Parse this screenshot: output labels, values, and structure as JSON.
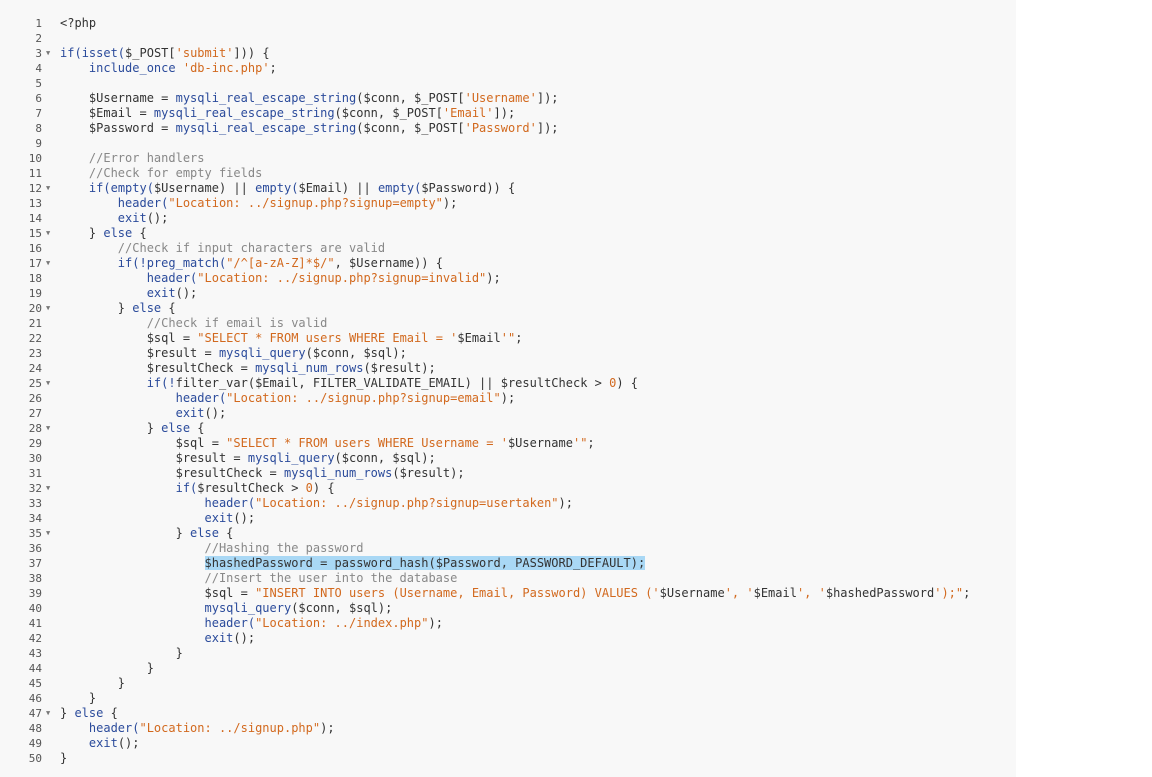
{
  "colors": {
    "background": "#f8f8f8",
    "plain": "#333333",
    "comment": "#888888",
    "string": "#d2691e",
    "function": "#2b4b9b",
    "selection": "#a9d8f5"
  },
  "lines": [
    {
      "n": "1",
      "fold": false,
      "segs": [
        {
          "t": "<?php",
          "c": "p"
        }
      ]
    },
    {
      "n": "2",
      "fold": false,
      "segs": []
    },
    {
      "n": "3",
      "fold": true,
      "segs": [
        {
          "t": "if(",
          "c": "f"
        },
        {
          "t": "isset(",
          "c": "f"
        },
        {
          "t": "$_POST[",
          "c": "p"
        },
        {
          "t": "'submit'",
          "c": "s"
        },
        {
          "t": "])) {",
          "c": "p"
        }
      ]
    },
    {
      "n": "4",
      "fold": false,
      "segs": [
        {
          "t": "    ",
          "c": "p"
        },
        {
          "t": "include_once",
          "c": "f"
        },
        {
          "t": " ",
          "c": "p"
        },
        {
          "t": "'db-inc.php'",
          "c": "s"
        },
        {
          "t": ";",
          "c": "p"
        }
      ]
    },
    {
      "n": "5",
      "fold": false,
      "segs": []
    },
    {
      "n": "6",
      "fold": false,
      "segs": [
        {
          "t": "    $Username = ",
          "c": "p"
        },
        {
          "t": "mysqli_real_escape_string",
          "c": "f"
        },
        {
          "t": "($conn, $_POST[",
          "c": "p"
        },
        {
          "t": "'Username'",
          "c": "s"
        },
        {
          "t": "]);",
          "c": "p"
        }
      ]
    },
    {
      "n": "7",
      "fold": false,
      "segs": [
        {
          "t": "    $Email = ",
          "c": "p"
        },
        {
          "t": "mysqli_real_escape_string",
          "c": "f"
        },
        {
          "t": "($conn, $_POST[",
          "c": "p"
        },
        {
          "t": "'Email'",
          "c": "s"
        },
        {
          "t": "]);",
          "c": "p"
        }
      ]
    },
    {
      "n": "8",
      "fold": false,
      "segs": [
        {
          "t": "    $Password = ",
          "c": "p"
        },
        {
          "t": "mysqli_real_escape_string",
          "c": "f"
        },
        {
          "t": "($conn, $_POST[",
          "c": "p"
        },
        {
          "t": "'Password'",
          "c": "s"
        },
        {
          "t": "]);",
          "c": "p"
        }
      ]
    },
    {
      "n": "9",
      "fold": false,
      "segs": []
    },
    {
      "n": "10",
      "fold": false,
      "segs": [
        {
          "t": "    //Error handlers",
          "c": "c"
        }
      ]
    },
    {
      "n": "11",
      "fold": false,
      "segs": [
        {
          "t": "    //Check for empty fields",
          "c": "c"
        }
      ]
    },
    {
      "n": "12",
      "fold": true,
      "segs": [
        {
          "t": "    ",
          "c": "p"
        },
        {
          "t": "if(",
          "c": "f"
        },
        {
          "t": "empty(",
          "c": "f"
        },
        {
          "t": "$Username) || ",
          "c": "p"
        },
        {
          "t": "empty(",
          "c": "f"
        },
        {
          "t": "$Email) || ",
          "c": "p"
        },
        {
          "t": "empty(",
          "c": "f"
        },
        {
          "t": "$Password)) {",
          "c": "p"
        }
      ]
    },
    {
      "n": "13",
      "fold": false,
      "segs": [
        {
          "t": "        ",
          "c": "p"
        },
        {
          "t": "header(",
          "c": "f"
        },
        {
          "t": "\"Location: ../signup.php?signup=empty\"",
          "c": "s"
        },
        {
          "t": ");",
          "c": "p"
        }
      ]
    },
    {
      "n": "14",
      "fold": false,
      "segs": [
        {
          "t": "        ",
          "c": "p"
        },
        {
          "t": "exit",
          "c": "f"
        },
        {
          "t": "();",
          "c": "p"
        }
      ]
    },
    {
      "n": "15",
      "fold": true,
      "segs": [
        {
          "t": "    } ",
          "c": "p"
        },
        {
          "t": "else",
          "c": "f"
        },
        {
          "t": " {",
          "c": "p"
        }
      ]
    },
    {
      "n": "16",
      "fold": false,
      "segs": [
        {
          "t": "        //Check if input characters are valid",
          "c": "c"
        }
      ]
    },
    {
      "n": "17",
      "fold": true,
      "segs": [
        {
          "t": "        ",
          "c": "p"
        },
        {
          "t": "if(!",
          "c": "f"
        },
        {
          "t": "preg_match(",
          "c": "f"
        },
        {
          "t": "\"/^[a-zA-Z]*$/\"",
          "c": "s"
        },
        {
          "t": ", $Username)) {",
          "c": "p"
        }
      ]
    },
    {
      "n": "18",
      "fold": false,
      "segs": [
        {
          "t": "            ",
          "c": "p"
        },
        {
          "t": "header(",
          "c": "f"
        },
        {
          "t": "\"Location: ../signup.php?signup=invalid\"",
          "c": "s"
        },
        {
          "t": ");",
          "c": "p"
        }
      ]
    },
    {
      "n": "19",
      "fold": false,
      "segs": [
        {
          "t": "            ",
          "c": "p"
        },
        {
          "t": "exit",
          "c": "f"
        },
        {
          "t": "();",
          "c": "p"
        }
      ]
    },
    {
      "n": "20",
      "fold": true,
      "segs": [
        {
          "t": "        } ",
          "c": "p"
        },
        {
          "t": "else",
          "c": "f"
        },
        {
          "t": " {",
          "c": "p"
        }
      ]
    },
    {
      "n": "21",
      "fold": false,
      "segs": [
        {
          "t": "            //Check if email is valid",
          "c": "c"
        }
      ]
    },
    {
      "n": "22",
      "fold": false,
      "segs": [
        {
          "t": "            $sql = ",
          "c": "p"
        },
        {
          "t": "\"SELECT * FROM users WHERE Email = '",
          "c": "s"
        },
        {
          "t": "$Email",
          "c": "p"
        },
        {
          "t": "'\"",
          "c": "s"
        },
        {
          "t": ";",
          "c": "p"
        }
      ]
    },
    {
      "n": "23",
      "fold": false,
      "segs": [
        {
          "t": "            $result = ",
          "c": "p"
        },
        {
          "t": "mysqli_query",
          "c": "f"
        },
        {
          "t": "($conn, $sql);",
          "c": "p"
        }
      ]
    },
    {
      "n": "24",
      "fold": false,
      "segs": [
        {
          "t": "            $resultCheck = ",
          "c": "p"
        },
        {
          "t": "mysqli_num_rows",
          "c": "f"
        },
        {
          "t": "($result);",
          "c": "p"
        }
      ]
    },
    {
      "n": "25",
      "fold": true,
      "segs": [
        {
          "t": "            ",
          "c": "p"
        },
        {
          "t": "if(!",
          "c": "f"
        },
        {
          "t": "filter_var($Email, FILTER_VALIDATE_EMAIL) || $resultCheck > ",
          "c": "p"
        },
        {
          "t": "0",
          "c": "s"
        },
        {
          "t": ") {",
          "c": "p"
        }
      ]
    },
    {
      "n": "26",
      "fold": false,
      "segs": [
        {
          "t": "                ",
          "c": "p"
        },
        {
          "t": "header(",
          "c": "f"
        },
        {
          "t": "\"Location: ../signup.php?signup=email\"",
          "c": "s"
        },
        {
          "t": ");",
          "c": "p"
        }
      ]
    },
    {
      "n": "27",
      "fold": false,
      "segs": [
        {
          "t": "                ",
          "c": "p"
        },
        {
          "t": "exit",
          "c": "f"
        },
        {
          "t": "();",
          "c": "p"
        }
      ]
    },
    {
      "n": "28",
      "fold": true,
      "segs": [
        {
          "t": "            } ",
          "c": "p"
        },
        {
          "t": "else",
          "c": "f"
        },
        {
          "t": " {",
          "c": "p"
        }
      ]
    },
    {
      "n": "29",
      "fold": false,
      "segs": [
        {
          "t": "                $sql = ",
          "c": "p"
        },
        {
          "t": "\"SELECT * FROM users WHERE Username = '",
          "c": "s"
        },
        {
          "t": "$Username",
          "c": "p"
        },
        {
          "t": "'\"",
          "c": "s"
        },
        {
          "t": ";",
          "c": "p"
        }
      ]
    },
    {
      "n": "30",
      "fold": false,
      "segs": [
        {
          "t": "                $result = ",
          "c": "p"
        },
        {
          "t": "mysqli_query",
          "c": "f"
        },
        {
          "t": "($conn, $sql);",
          "c": "p"
        }
      ]
    },
    {
      "n": "31",
      "fold": false,
      "segs": [
        {
          "t": "                $resultCheck = ",
          "c": "p"
        },
        {
          "t": "mysqli_num_rows",
          "c": "f"
        },
        {
          "t": "($result);",
          "c": "p"
        }
      ]
    },
    {
      "n": "32",
      "fold": true,
      "segs": [
        {
          "t": "                ",
          "c": "p"
        },
        {
          "t": "if(",
          "c": "f"
        },
        {
          "t": "$resultCheck > ",
          "c": "p"
        },
        {
          "t": "0",
          "c": "s"
        },
        {
          "t": ") {",
          "c": "p"
        }
      ]
    },
    {
      "n": "33",
      "fold": false,
      "segs": [
        {
          "t": "                    ",
          "c": "p"
        },
        {
          "t": "header(",
          "c": "f"
        },
        {
          "t": "\"Location: ../signup.php?signup=usertaken\"",
          "c": "s"
        },
        {
          "t": ");",
          "c": "p"
        }
      ]
    },
    {
      "n": "34",
      "fold": false,
      "segs": [
        {
          "t": "                    ",
          "c": "p"
        },
        {
          "t": "exit",
          "c": "f"
        },
        {
          "t": "();",
          "c": "p"
        }
      ]
    },
    {
      "n": "35",
      "fold": true,
      "segs": [
        {
          "t": "                } ",
          "c": "p"
        },
        {
          "t": "else",
          "c": "f"
        },
        {
          "t": " {",
          "c": "p"
        }
      ]
    },
    {
      "n": "36",
      "fold": false,
      "segs": [
        {
          "t": "                    //Hashing the password",
          "c": "c"
        }
      ]
    },
    {
      "n": "37",
      "fold": false,
      "segs": [
        {
          "t": "                    ",
          "c": "p"
        },
        {
          "t": "$hashedPassword = password_hash($Password, PASSWORD_DEFAULT);",
          "c": "h"
        }
      ]
    },
    {
      "n": "38",
      "fold": false,
      "segs": [
        {
          "t": "                    //Insert the user into the database",
          "c": "c"
        }
      ]
    },
    {
      "n": "39",
      "fold": false,
      "segs": [
        {
          "t": "                    $sql = ",
          "c": "p"
        },
        {
          "t": "\"INSERT INTO users (Username, Email, Password) VALUES ('",
          "c": "s"
        },
        {
          "t": "$Username",
          "c": "p"
        },
        {
          "t": "', '",
          "c": "s"
        },
        {
          "t": "$Email",
          "c": "p"
        },
        {
          "t": "', '",
          "c": "s"
        },
        {
          "t": "$hashedPassword",
          "c": "p"
        },
        {
          "t": "');\"",
          "c": "s"
        },
        {
          "t": ";",
          "c": "p"
        }
      ]
    },
    {
      "n": "40",
      "fold": false,
      "segs": [
        {
          "t": "                    ",
          "c": "p"
        },
        {
          "t": "mysqli_query",
          "c": "f"
        },
        {
          "t": "($conn, $sql);",
          "c": "p"
        }
      ]
    },
    {
      "n": "41",
      "fold": false,
      "segs": [
        {
          "t": "                    ",
          "c": "p"
        },
        {
          "t": "header(",
          "c": "f"
        },
        {
          "t": "\"Location: ../index.php\"",
          "c": "s"
        },
        {
          "t": ");",
          "c": "p"
        }
      ]
    },
    {
      "n": "42",
      "fold": false,
      "segs": [
        {
          "t": "                    ",
          "c": "p"
        },
        {
          "t": "exit",
          "c": "f"
        },
        {
          "t": "();",
          "c": "p"
        }
      ]
    },
    {
      "n": "43",
      "fold": false,
      "segs": [
        {
          "t": "                }",
          "c": "p"
        }
      ]
    },
    {
      "n": "44",
      "fold": false,
      "segs": [
        {
          "t": "            }",
          "c": "p"
        }
      ]
    },
    {
      "n": "45",
      "fold": false,
      "segs": [
        {
          "t": "        }",
          "c": "p"
        }
      ]
    },
    {
      "n": "46",
      "fold": false,
      "segs": [
        {
          "t": "    }",
          "c": "p"
        }
      ]
    },
    {
      "n": "47",
      "fold": true,
      "segs": [
        {
          "t": "} ",
          "c": "p"
        },
        {
          "t": "else",
          "c": "f"
        },
        {
          "t": " {",
          "c": "p"
        }
      ]
    },
    {
      "n": "48",
      "fold": false,
      "segs": [
        {
          "t": "    ",
          "c": "p"
        },
        {
          "t": "header(",
          "c": "f"
        },
        {
          "t": "\"Location: ../signup.php\"",
          "c": "s"
        },
        {
          "t": ");",
          "c": "p"
        }
      ]
    },
    {
      "n": "49",
      "fold": false,
      "segs": [
        {
          "t": "    ",
          "c": "p"
        },
        {
          "t": "exit",
          "c": "f"
        },
        {
          "t": "();",
          "c": "p"
        }
      ]
    },
    {
      "n": "50",
      "fold": false,
      "segs": [
        {
          "t": "}",
          "c": "p"
        }
      ]
    }
  ],
  "fold_glyph": "▼"
}
